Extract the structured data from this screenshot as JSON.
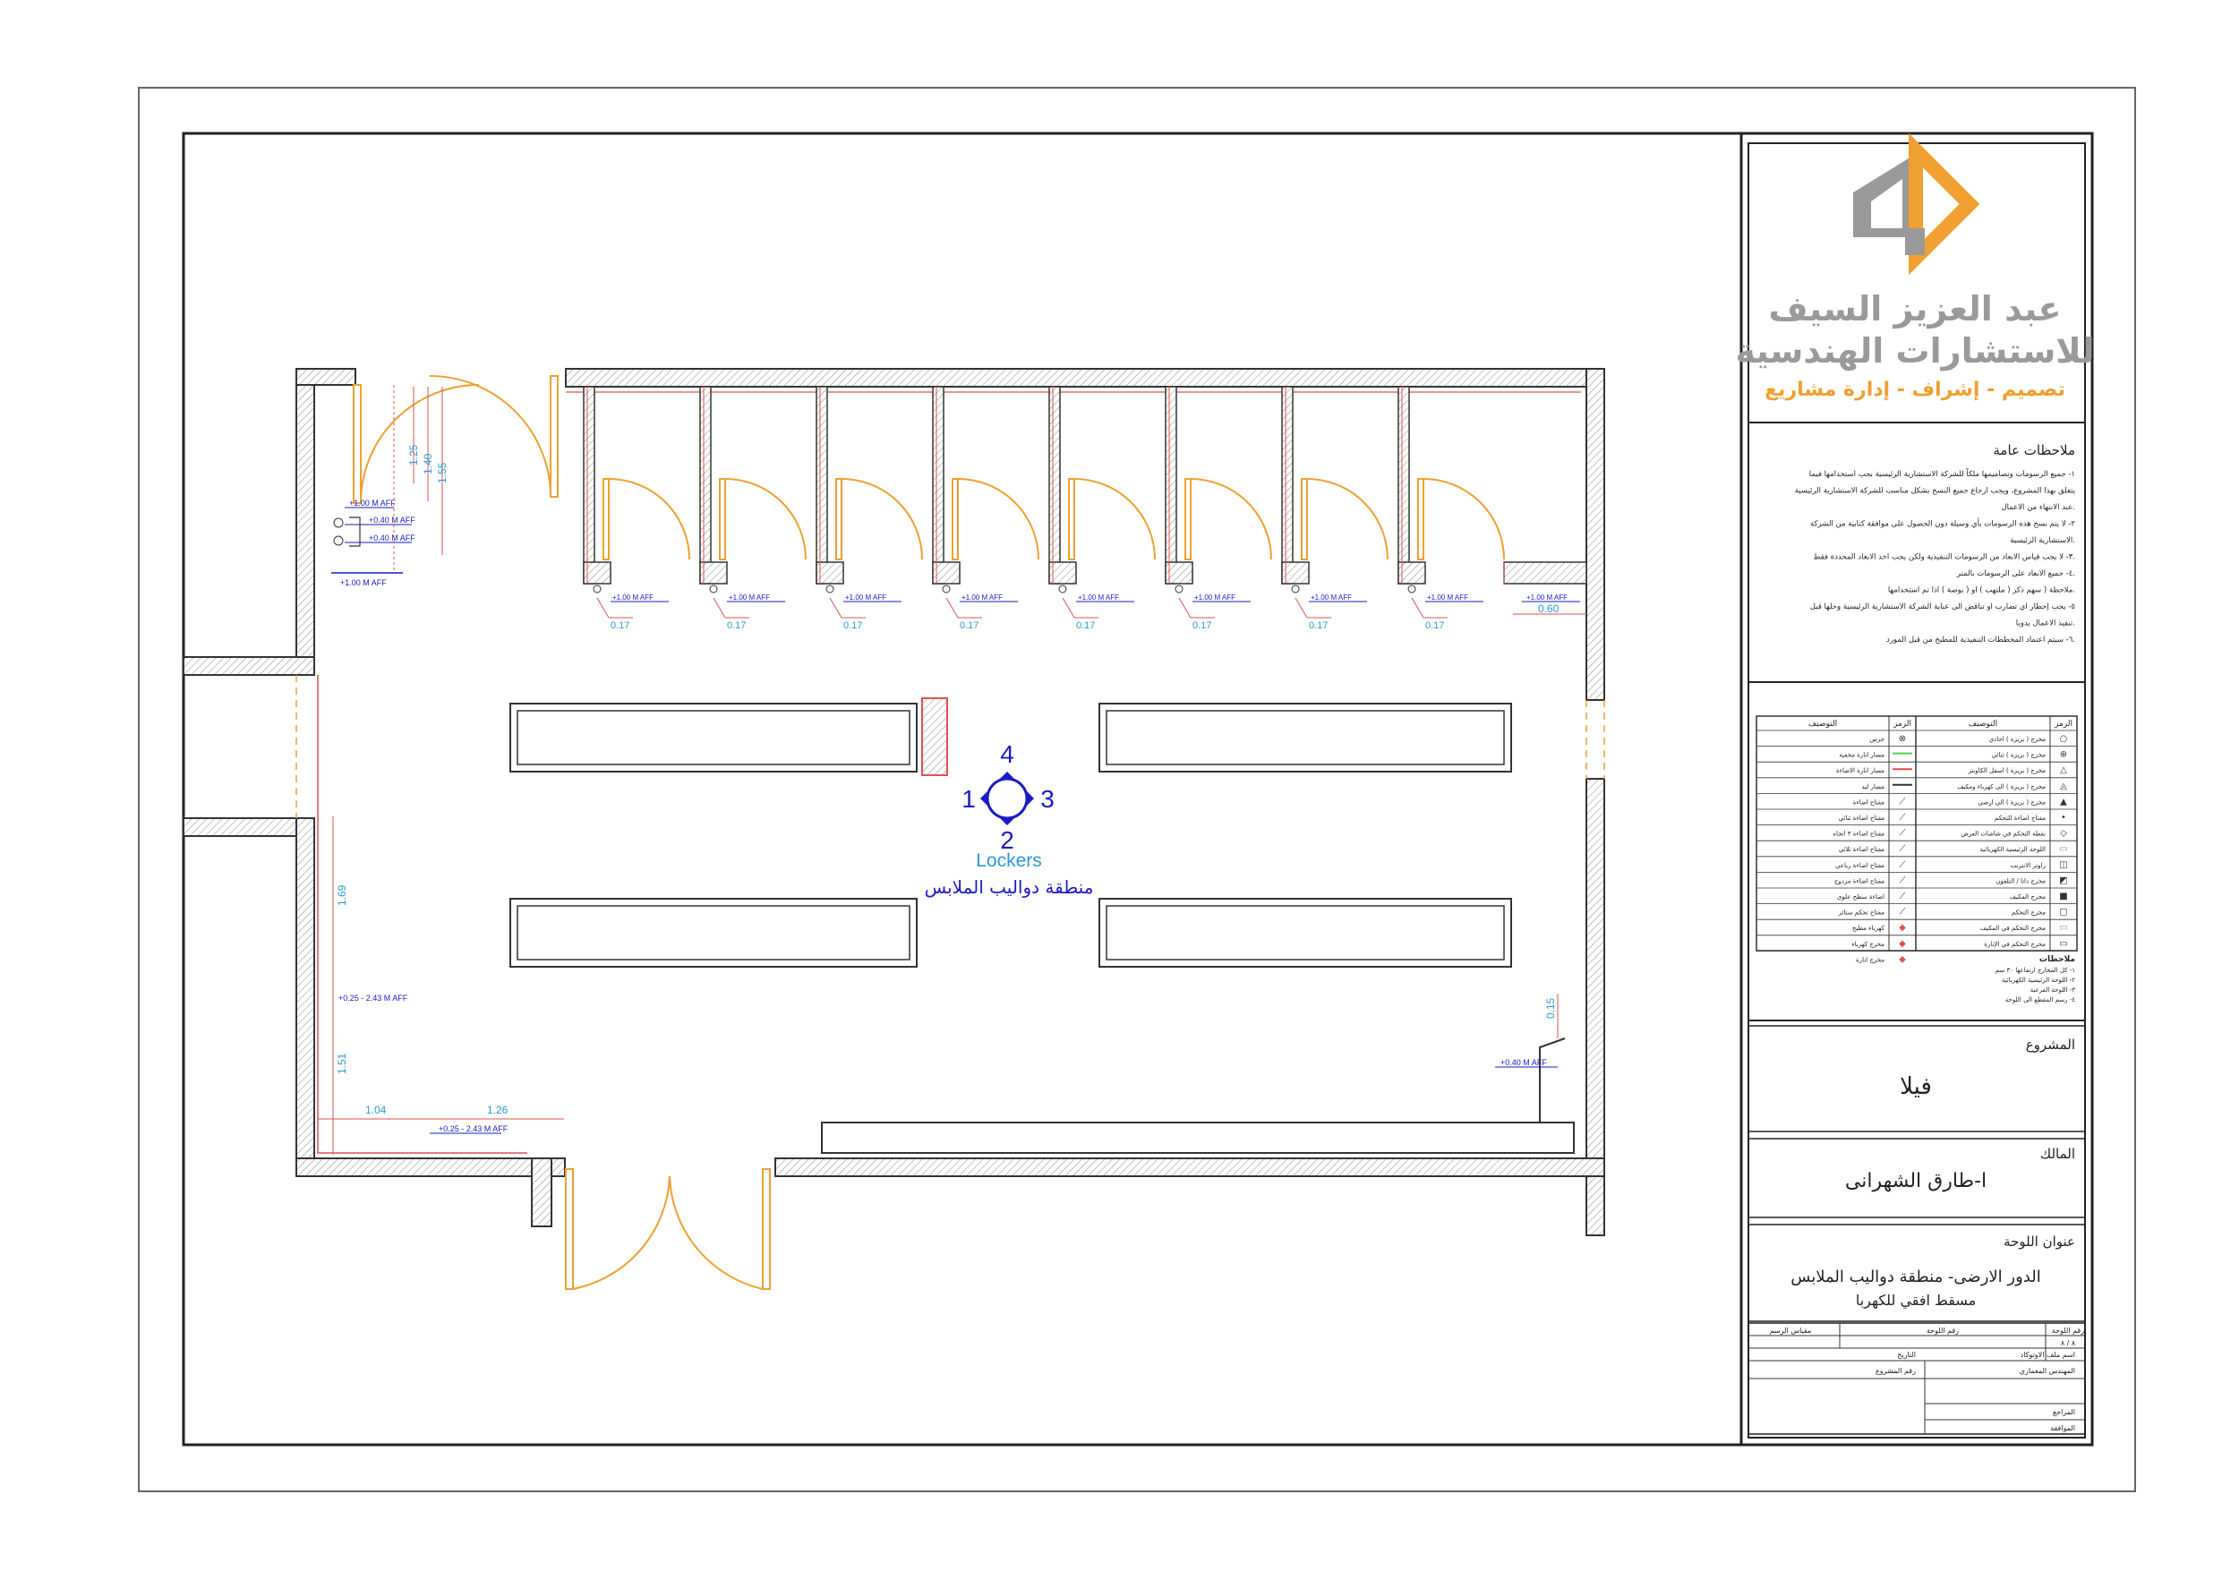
{
  "colors": {
    "wall": "#444444",
    "door": "#f0a030",
    "red": "#e05050",
    "blue": "#1a1ac8",
    "dim": "#2a9ad6",
    "logo_gray": "#9a9a9a",
    "logo_orange": "#f0a030",
    "green": "#4bd14b"
  },
  "compass": {
    "n1": "1",
    "n2": "2",
    "n3": "3",
    "n4": "4"
  },
  "room": {
    "label_en": "Lockers",
    "label_ar": "منطقة دواليب الملابس"
  },
  "dims": {
    "d125": "1.25",
    "d140": "1.40",
    "d155": "1.55",
    "d169": "1.69",
    "d151": "1.51",
    "d104": "1.04",
    "d126": "1.26",
    "d015": "0.15",
    "d060": "0.60",
    "d017": "0.17"
  },
  "aff": {
    "a100": "+1.00 M AFF",
    "a040": "+0.40 M AFF",
    "a025": "+0.25 - 2.43 M AFF",
    "a040b": "+0.40 M AFF"
  },
  "logo": {
    "line1": "عبد العزيز السيف",
    "line2": "للاستشارات الهندسية",
    "line3": "تصميم - إشراف - إدارة مشاريع"
  },
  "notes": {
    "title": "ملاحظات عامة",
    "items": [
      "١- جميع الرسومات وتصاميمها ملكاً للشركة الاستشارية الرئيسية يجب استخدامها فيما",
      "يتعلق بهذا المشروع، ويجب ارجاع جميع النسخ بشكل مناسب للشركة الاستشارية الرئيسية",
      "عند الانتهاء من الاعمال.",
      "٢- لا يتم نسخ هذه الرسومات بأي وسيلة دون الحصول على موافقة كتابية من الشركة",
      "الاستشارية الرئيسية.",
      "٣- لا يجب قياس الابعاد من الرسومات التنفيذية ولكن يجب اخذ الابعاد المحددة فقط.",
      "٤- جميع الابعاد على الرسومات بالمتر.",
      "ملاحظة ( سهم ذكر ( ملتهب ) او ( بوصة ) اذا تم استخدامها.",
      "٥- يجب إخطار اي تضارب او تناقض الى عناية الشركة الاستشارية الرئيسية وحلها قبل",
      "تنفيذ الاعمال يدويا.",
      "٦- سيتم اعتماد المخططات التنفيذية للمطبخ من قبل المورد."
    ]
  },
  "legend": {
    "h_sym": "الرمز",
    "h_desc": "التوصيف",
    "right_rows": [
      "مخرج ( بريزة ) احادي",
      "مخرج ( بريزة ) ثنائي",
      "مخرج ( بريزة ) اسفل الكاونتر",
      "مخرج ( بريزة ) الى كهرباء ومكيف",
      "مخرج ( بريزة ) الى ارضي",
      "مفتاح اضاءة للتحكم",
      "نقطة التحكم في شاشات العرض",
      "اللوحة الرئيسية الكهربائية",
      "راوتر الانترنت",
      "مخرج داتا / التلفون",
      "مخرج المكيف",
      "مخرج التحكم",
      "مخرج التحكم في المكيف",
      "مخرج التحكم في الإنارة"
    ],
    "left_rows": [
      "جرس",
      "مسار انارة مخفية",
      "مسار انارة الاضاءة",
      "مسار ليد",
      "مفتاح اضاءة",
      "مفتاح اضاءة ثنائي",
      "مفتاح اضاءة ٣ اتجاه",
      "مفتاح اضاءة ثلاثي",
      "مفتاح اضاءة رباعي",
      "مفتاح اضاءة مزدوج",
      "اضاءة سطح علوي",
      "مفتاح تحكم ستائر",
      "كهرباء مطبخ",
      "مخرج كهرباء",
      "مخرج انارة"
    ],
    "notes_title": "ملاحظات",
    "notes": [
      "١- كل المخارج ارتفاعها ٣٠ سم",
      "٢- اللوحة الرئيسية الكهربائية",
      "٣- اللوحة الفرعية",
      "٤- رسم المقطع الى اللوحة"
    ]
  },
  "project": {
    "label": "المشروع",
    "value": "فيلا"
  },
  "owner": {
    "label": "المالك",
    "value": "ا-طارق الشهرانى"
  },
  "sheet": {
    "label": "عنوان اللوحة",
    "line1": "الدور الارضى- منطقة دواليب الملابس",
    "line2": "مسقط افقي للكهربا"
  },
  "info": {
    "sheet_no_label": "رقم اللوحة",
    "scale_label": "مقياس الرسم",
    "seq_label": "رقم اللوحة",
    "seq_value": "٨ / ٨",
    "file_label": "اسم ملف الاوتوكاد",
    "date_label": "التاريخ",
    "eng_label": "المهندس المعماري",
    "proj_no_label": "رقم المشروع",
    "review_label": "المراجع",
    "approve_label": "الموافقة"
  }
}
